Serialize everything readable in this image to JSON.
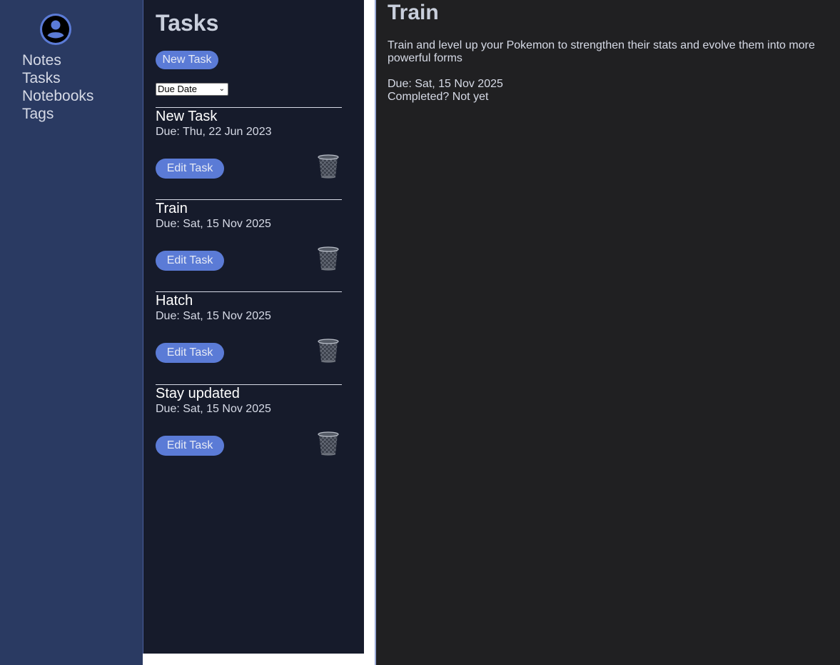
{
  "sidebar": {
    "avatar_icon": "user-circle-icon",
    "nav": [
      {
        "label": "Notes"
      },
      {
        "label": "Tasks"
      },
      {
        "label": "Notebooks"
      },
      {
        "label": "Tags"
      }
    ]
  },
  "tasks_panel": {
    "title": "Tasks",
    "new_task_label": "New Task",
    "sort_selected": "Due Date",
    "edit_label": "Edit Task",
    "delete_icon": "trash-icon",
    "items": [
      {
        "name": "New Task",
        "due": "Due: Thu, 22 Jun 2023"
      },
      {
        "name": "Train",
        "due": "Due: Sat, 15 Nov 2025"
      },
      {
        "name": "Hatch",
        "due": "Due: Sat, 15 Nov 2025"
      },
      {
        "name": "Stay updated",
        "due": "Due: Sat, 15 Nov 2025"
      }
    ]
  },
  "detail": {
    "title": "Train",
    "description": "Train and level up your Pokemon to strengthen their stats and evolve them into more powerful forms",
    "due": "Due: Sat, 15 Nov 2025",
    "completed": "Completed? Not yet"
  },
  "colors": {
    "sidebar_bg": "#2a3a62",
    "panel_bg": "#161b2b",
    "detail_bg": "#202022",
    "accent": "#5b7bd6"
  }
}
